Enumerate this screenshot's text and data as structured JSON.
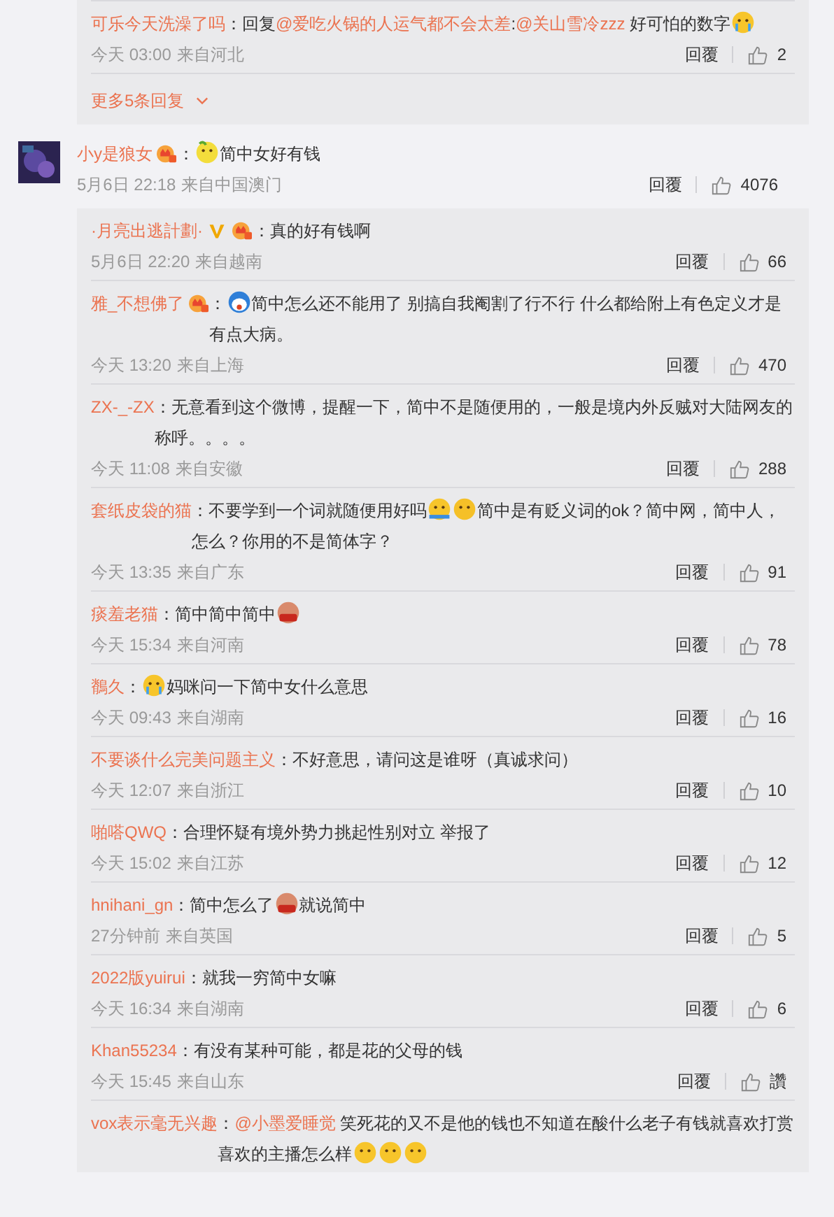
{
  "top_thread": {
    "replies": [
      {
        "user": "可乐今天洗澡了吗",
        "segments": [
          {
            "kind": "text",
            "text": "：回复"
          },
          {
            "kind": "mention",
            "text": "@爱吃火锅的人运气都不会太差"
          },
          {
            "kind": "text",
            "text": ":"
          },
          {
            "kind": "mention",
            "text": "@关山雪冷zzz"
          },
          {
            "kind": "text",
            "text": " 好可怕的数字"
          },
          {
            "kind": "crying"
          }
        ],
        "time": "今天 03:00",
        "location": "来自河北",
        "reply_label": "回覆",
        "likes": "2"
      }
    ],
    "more_replies": "更多5条回复"
  },
  "comment": {
    "user": "小y是狼女",
    "badges": [
      {
        "kind": "vip"
      }
    ],
    "segments": [
      {
        "kind": "text",
        "text": "："
      },
      {
        "kind": "lemon"
      },
      {
        "kind": "text",
        "text": "简中女好有钱"
      }
    ],
    "time": "5月6日 22:18",
    "location": "来自中国澳门",
    "reply_label": "回覆",
    "likes": "4076"
  },
  "replies": [
    {
      "user": "·月亮出逃計劃·",
      "badges": [
        {
          "kind": "verified"
        },
        {
          "kind": "vip"
        }
      ],
      "segments": [
        {
          "kind": "text",
          "text": "：真的好有钱啊"
        }
      ],
      "time": "5月6日 22:20",
      "location": "来自越南",
      "reply_label": "回覆",
      "likes": "66"
    },
    {
      "user": "雅_不想佛了",
      "badges": [
        {
          "kind": "vip"
        }
      ],
      "segments": [
        {
          "kind": "text",
          "text": "："
        },
        {
          "kind": "bluecat"
        },
        {
          "kind": "text",
          "text": "简中怎么还不能用了 别搞自我阉割了行不行 什么都给附上有色定义才是有点大病。"
        }
      ],
      "time": "今天 13:20",
      "location": "来自上海",
      "reply_label": "回覆",
      "likes": "470"
    },
    {
      "user": "ZX-_-ZX",
      "segments": [
        {
          "kind": "text",
          "text": "：无意看到这个微博，提醒一下，简中不是随便用的，一般是境内外反贼对大陆网友的称呼。。。。"
        }
      ],
      "time": "今天 11:08",
      "location": "来自安徽",
      "reply_label": "回覆",
      "likes": "288"
    },
    {
      "user": "套纸皮袋的猫",
      "segments": [
        {
          "kind": "text",
          "text": "：不要学到一个词就随便用好吗"
        },
        {
          "kind": "shrug"
        },
        {
          "kind": "smirk"
        },
        {
          "kind": "text",
          "text": "简中是有贬义词的ok？简中网，简中人，怎么？你用的不是简体字？"
        }
      ],
      "time": "今天 13:35",
      "location": "来自广东",
      "reply_label": "回覆",
      "likes": "91"
    },
    {
      "user": "痰羞老猫",
      "segments": [
        {
          "kind": "text",
          "text": "：简中简中简中"
        },
        {
          "kind": "bowl"
        }
      ],
      "time": "今天 15:34",
      "location": "来自河南",
      "reply_label": "回覆",
      "likes": "78"
    },
    {
      "user": "鶺久",
      "segments": [
        {
          "kind": "text",
          "text": "："
        },
        {
          "kind": "crying"
        },
        {
          "kind": "text",
          "text": "妈咪问一下简中女什么意思"
        }
      ],
      "time": "今天 09:43",
      "location": "来自湖南",
      "reply_label": "回覆",
      "likes": "16"
    },
    {
      "user": "不要谈什么完美问题主义",
      "segments": [
        {
          "kind": "text",
          "text": "：不好意思，请问这是谁呀（真诚求问）"
        }
      ],
      "time": "今天 12:07",
      "location": "来自浙江",
      "reply_label": "回覆",
      "likes": "10"
    },
    {
      "user": "啪嗒QWQ",
      "segments": [
        {
          "kind": "text",
          "text": "：合理怀疑有境外势力挑起性别对立 举报了"
        }
      ],
      "time": "今天 15:02",
      "location": "来自江苏",
      "reply_label": "回覆",
      "likes": "12"
    },
    {
      "user": "hnihani_gn",
      "segments": [
        {
          "kind": "text",
          "text": "：简中怎么了"
        },
        {
          "kind": "bowl"
        },
        {
          "kind": "text",
          "text": "就说简中"
        }
      ],
      "time": "27分钟前",
      "location": "来自英国",
      "reply_label": "回覆",
      "likes": "5"
    },
    {
      "user": "2022版yuirui",
      "segments": [
        {
          "kind": "text",
          "text": "：就我一穷简中女嘛"
        }
      ],
      "time": "今天 16:34",
      "location": "来自湖南",
      "reply_label": "回覆",
      "likes": "6"
    },
    {
      "user": "Khan55234",
      "segments": [
        {
          "kind": "text",
          "text": "：有没有某种可能，都是花的父母的钱"
        }
      ],
      "time": "今天 15:45",
      "location": "来自山东",
      "reply_label": "回覆",
      "likes": "讚"
    },
    {
      "user": "vox表示毫无兴趣",
      "segments": [
        {
          "kind": "text",
          "text": "："
        },
        {
          "kind": "mention",
          "text": "@小墨爱睡觉"
        },
        {
          "kind": "text",
          "text": " 笑死花的又不是他的钱也不知道在酸什么老子有钱就喜欢打赏喜欢的主播怎么样"
        },
        {
          "kind": "pleading"
        },
        {
          "kind": "pleading"
        },
        {
          "kind": "pleading"
        }
      ]
    }
  ]
}
